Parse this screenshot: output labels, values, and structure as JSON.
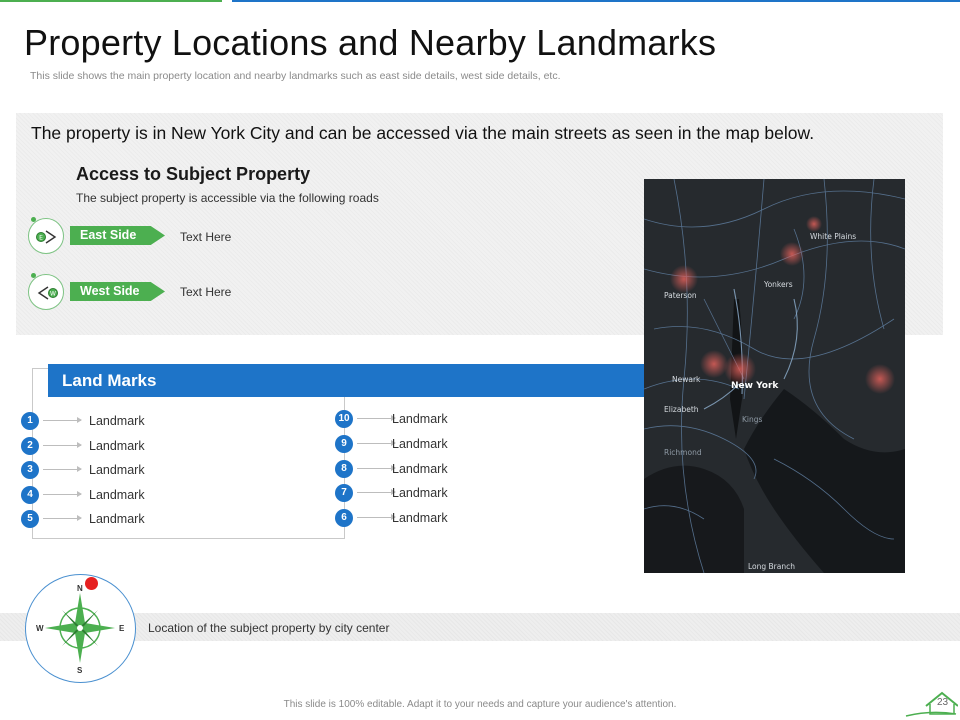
{
  "header": {
    "title": "Property Locations and Nearby Landmarks",
    "subtitle": "This slide shows the main property location and nearby landmarks such as east side details, west side details, etc."
  },
  "panel": {
    "statement": "The property is in New York City and can be accessed via the main streets as seen in the map below.",
    "access_title": "Access to Subject Property",
    "access_subtitle": "The subject property is accessible via the following roads",
    "roads": [
      {
        "label": "East Side",
        "text": "Text Here",
        "icon": "east-arrow-icon"
      },
      {
        "label": "West Side",
        "text": "Text Here",
        "icon": "west-arrow-icon"
      }
    ]
  },
  "landmarks": {
    "title": "Land Marks",
    "left": [
      {
        "num": "1",
        "label": "Landmark"
      },
      {
        "num": "2",
        "label": "Landmark"
      },
      {
        "num": "3",
        "label": "Landmark"
      },
      {
        "num": "4",
        "label": "Landmark"
      },
      {
        "num": "5",
        "label": "Landmark"
      }
    ],
    "right": [
      {
        "num": "10",
        "label": "Landmark"
      },
      {
        "num": "9",
        "label": "Landmark"
      },
      {
        "num": "8",
        "label": "Landmark"
      },
      {
        "num": "7",
        "label": "Landmark"
      },
      {
        "num": "6",
        "label": "Landmark"
      }
    ]
  },
  "map": {
    "labels": [
      "White Plains",
      "Paterson",
      "Yonkers",
      "Newark",
      "New York",
      "Elizabeth",
      "Kings",
      "Richmond",
      "Long Branch"
    ]
  },
  "compass": {
    "north": "N",
    "south": "S",
    "east": "E",
    "west": "W",
    "caption": "Location of the subject property by city center"
  },
  "footer": {
    "note": "This slide is 100% editable. Adapt it to your needs and capture your audience's attention.",
    "page_number": "23"
  },
  "colors": {
    "accent_blue": "#1e74c8",
    "accent_green": "#4caf50",
    "marker_red": "#e62020"
  }
}
